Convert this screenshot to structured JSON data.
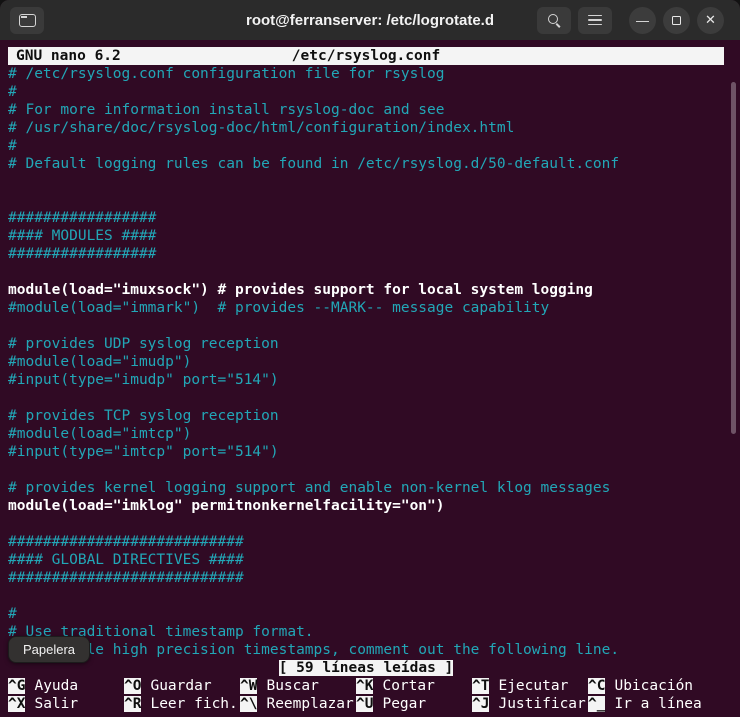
{
  "window": {
    "title": "root@ferranserver: /etc/logrotate.d",
    "controls": {
      "minimize": "—",
      "maximize": "▢",
      "close": "✕"
    }
  },
  "icons": {
    "left_button": "new-tab-icon",
    "search": "search-icon",
    "menu": "hamburger-icon"
  },
  "colors": {
    "terminal_bg": "#300a24",
    "titlebar_bg": "#2b2b2b",
    "comment_cyan": "#22a7b7",
    "text_white": "#ffffff",
    "inverse_bg": "#f4f4f4"
  },
  "nano": {
    "version": "GNU nano 6.2",
    "filename": "/etc/rsyslog.conf",
    "status": "[ 59 líneas leídas ]"
  },
  "editor": {
    "lines": [
      {
        "t": "# /etc/rsyslog.conf configuration file for rsyslog",
        "c": "cyan"
      },
      {
        "t": "#",
        "c": "cyan"
      },
      {
        "t": "# For more information install rsyslog-doc and see",
        "c": "cyan"
      },
      {
        "t": "# /usr/share/doc/rsyslog-doc/html/configuration/index.html",
        "c": "cyan"
      },
      {
        "t": "#",
        "c": "cyan"
      },
      {
        "t": "# Default logging rules can be found in /etc/rsyslog.d/50-default.conf",
        "c": "cyan"
      },
      {
        "t": "",
        "c": "cyan"
      },
      {
        "t": "",
        "c": "cyan"
      },
      {
        "t": "#################",
        "c": "cyan"
      },
      {
        "t": "#### MODULES ####",
        "c": "cyan"
      },
      {
        "t": "#################",
        "c": "cyan"
      },
      {
        "t": "",
        "c": "cyan"
      },
      {
        "t": "module(load=\"imuxsock\") # provides support for local system logging",
        "c": "white"
      },
      {
        "t": "#module(load=\"immark\")  # provides --MARK-- message capability",
        "c": "cyan"
      },
      {
        "t": "",
        "c": "cyan"
      },
      {
        "t": "# provides UDP syslog reception",
        "c": "cyan"
      },
      {
        "t": "#module(load=\"imudp\")",
        "c": "cyan"
      },
      {
        "t": "#input(type=\"imudp\" port=\"514\")",
        "c": "cyan"
      },
      {
        "t": "",
        "c": "cyan"
      },
      {
        "t": "# provides TCP syslog reception",
        "c": "cyan"
      },
      {
        "t": "#module(load=\"imtcp\")",
        "c": "cyan"
      },
      {
        "t": "#input(type=\"imtcp\" port=\"514\")",
        "c": "cyan"
      },
      {
        "t": "",
        "c": "cyan"
      },
      {
        "t": "# provides kernel logging support and enable non-kernel klog messages",
        "c": "cyan"
      },
      {
        "t": "module(load=\"imklog\" permitnonkernelfacility=\"on\")",
        "c": "white"
      },
      {
        "t": "",
        "c": "cyan"
      },
      {
        "t": "###########################",
        "c": "cyan"
      },
      {
        "t": "#### GLOBAL DIRECTIVES ####",
        "c": "cyan"
      },
      {
        "t": "###########################",
        "c": "cyan"
      },
      {
        "t": "",
        "c": "cyan"
      },
      {
        "t": "#",
        "c": "cyan"
      },
      {
        "t": "# Use traditional timestamp format.",
        "c": "cyan"
      },
      {
        "t": "# To enable high precision timestamps, comment out the following line.",
        "c": "cyan"
      }
    ]
  },
  "shortcuts": {
    "row1": [
      {
        "key": "^G",
        "label": "Ayuda"
      },
      {
        "key": "^O",
        "label": "Guardar"
      },
      {
        "key": "^W",
        "label": "Buscar"
      },
      {
        "key": "^K",
        "label": "Cortar"
      },
      {
        "key": "^T",
        "label": "Ejecutar"
      },
      {
        "key": "^C",
        "label": "Ubicación"
      }
    ],
    "row2": [
      {
        "key": "^X",
        "label": "Salir"
      },
      {
        "key": "^R",
        "label": "Leer fich."
      },
      {
        "key": "^\\",
        "label": "Reemplazar"
      },
      {
        "key": "^U",
        "label": "Pegar"
      },
      {
        "key": "^J",
        "label": "Justificar"
      },
      {
        "key": "^_",
        "label": "Ir a línea"
      }
    ]
  },
  "tooltip": {
    "label": "Papelera"
  }
}
